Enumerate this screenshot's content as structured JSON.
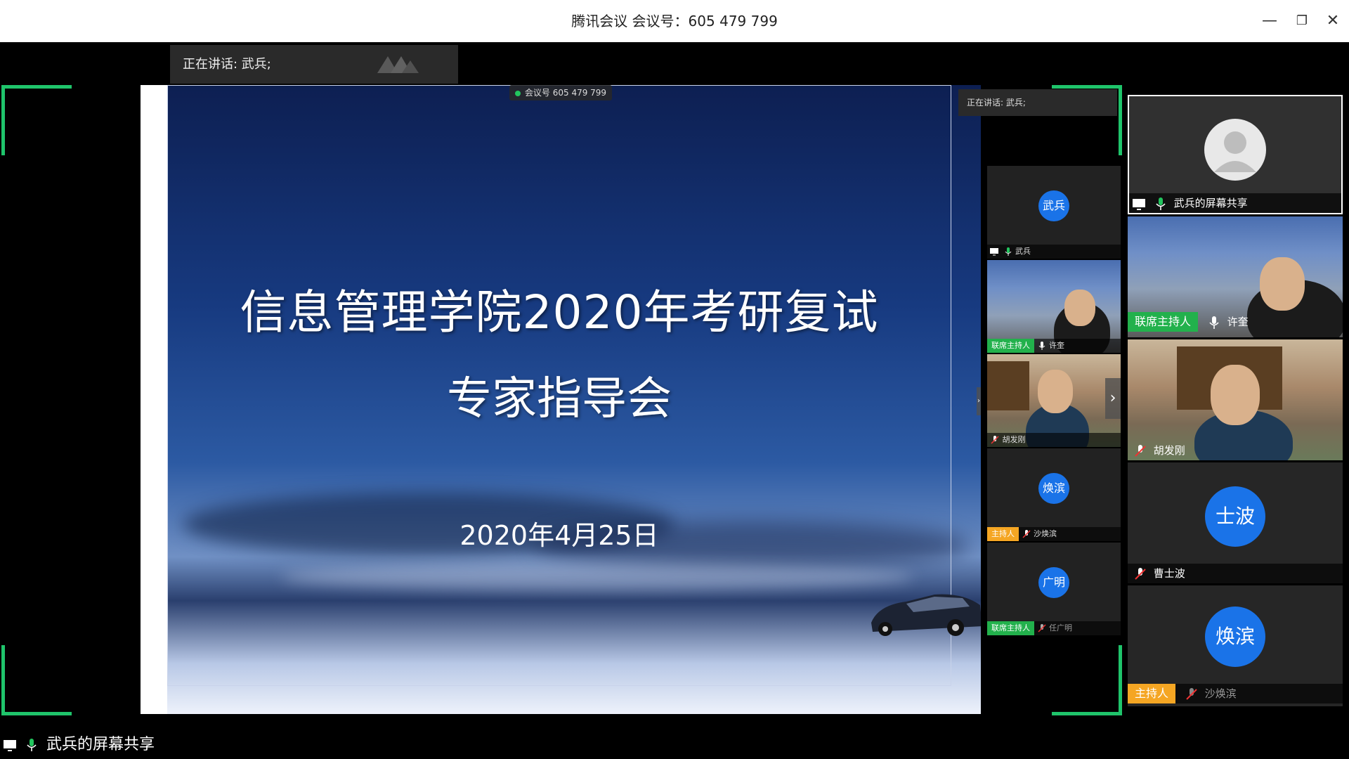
{
  "window": {
    "title": "腾讯会议 会议号：605 479 799",
    "minimize": "—",
    "restore": "❐",
    "close": "✕"
  },
  "speaking_banner": {
    "text": "正在讲话: 武兵;"
  },
  "slide": {
    "meeting_pill": "会议号 605 479 799",
    "title_line1": "信息管理学院2020年考研复试",
    "title_line2": "专家指导会",
    "date": "2020年4月25日"
  },
  "mid_panel": {
    "speaking": "正在讲话: 武兵;",
    "tiles": [
      {
        "avatar": "武兵",
        "name": "武兵",
        "tag": ""
      },
      {
        "avatar": "",
        "name": "许奎",
        "tag": "联席主持人"
      },
      {
        "avatar": "",
        "name": "胡发刚",
        "tag": ""
      },
      {
        "avatar": "焕滨",
        "name": "沙焕滨",
        "tag": "主持人"
      },
      {
        "avatar": "广明",
        "name": "任广明",
        "tag": "联席主持人"
      }
    ]
  },
  "right_panel": {
    "tiles": [
      {
        "name": "武兵的屏幕共享",
        "tag": ""
      },
      {
        "name": "许奎",
        "tag": "联席主持人"
      },
      {
        "name": "胡发刚",
        "tag": ""
      },
      {
        "avatar": "士波",
        "name": "曹士波",
        "tag": ""
      },
      {
        "avatar": "焕滨",
        "name": "沙焕滨",
        "tag": "主持人"
      }
    ]
  },
  "bottom_label": "武兵的屏幕共享",
  "colors": {
    "accent_green": "#1fc46b",
    "avatar_blue": "#1a73e8",
    "host_orange": "#f5a623",
    "cohost_green": "#22b14c"
  }
}
